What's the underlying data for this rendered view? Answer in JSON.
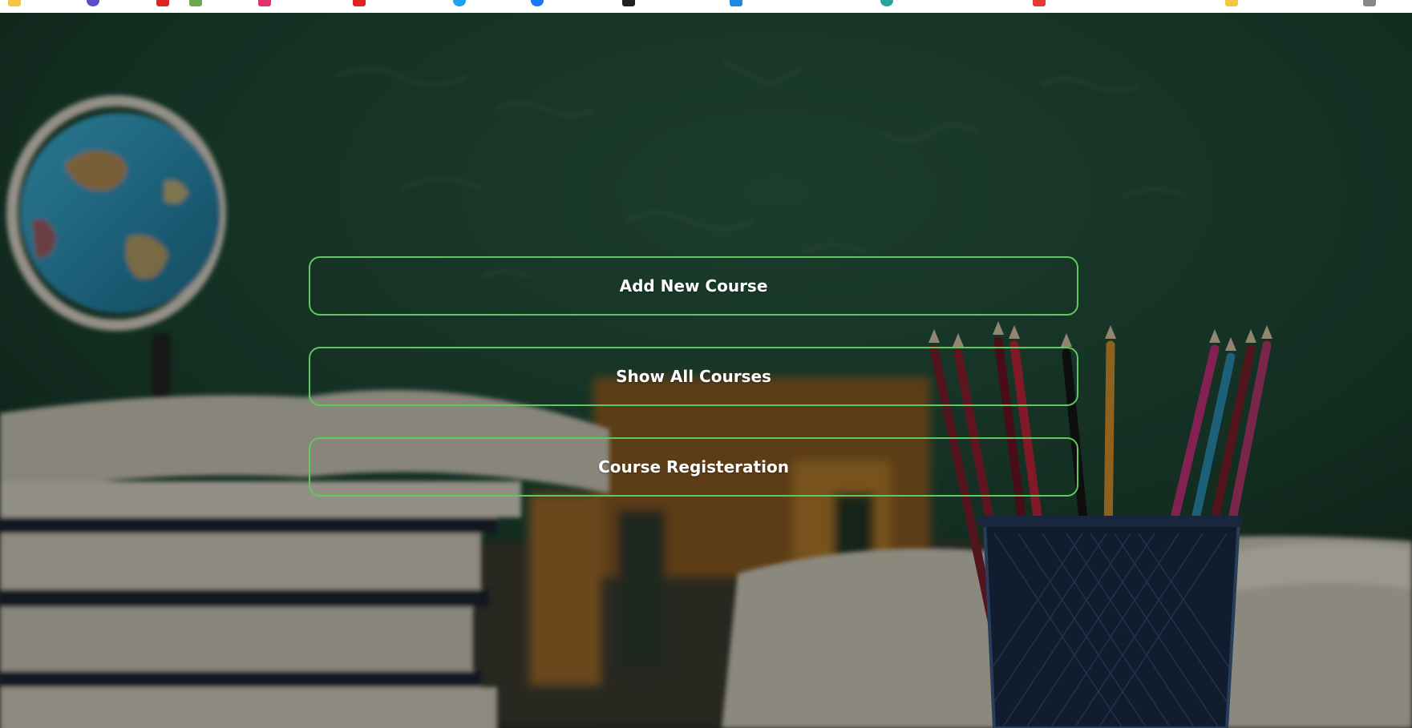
{
  "bookmarks_bar": {
    "icons": [
      {
        "name": "folder-icon",
        "color": "#f5c542"
      },
      {
        "name": "bookmark-icon",
        "color": "#5b4ec9"
      },
      {
        "name": "youtube-icon",
        "color": "#e02424"
      },
      {
        "name": "bookmark-icon",
        "color": "#6aa84f"
      },
      {
        "name": "instagram-icon",
        "color": "#e1306c"
      },
      {
        "name": "youtube-icon",
        "color": "#e02424"
      },
      {
        "name": "bookmark-icon",
        "color": "#1da1f2"
      },
      {
        "name": "facebook-icon",
        "color": "#1877f2"
      },
      {
        "name": "bookmark-icon",
        "color": "#222222"
      },
      {
        "name": "bookmark-icon",
        "color": "#1e88e5"
      },
      {
        "name": "bookmark-icon",
        "color": "#26a69a"
      },
      {
        "name": "bookmark-icon",
        "color": "#e53935"
      },
      {
        "name": "folder-icon",
        "color": "#f5c542"
      }
    ]
  },
  "menu": {
    "buttons": [
      {
        "label": "Add New Course"
      },
      {
        "label": "Show All Courses"
      },
      {
        "label": "Course Registeration"
      }
    ]
  },
  "colors": {
    "button_border": "#5ec95e",
    "button_text": "#ffffff",
    "chalkboard": "#1e4a36"
  }
}
